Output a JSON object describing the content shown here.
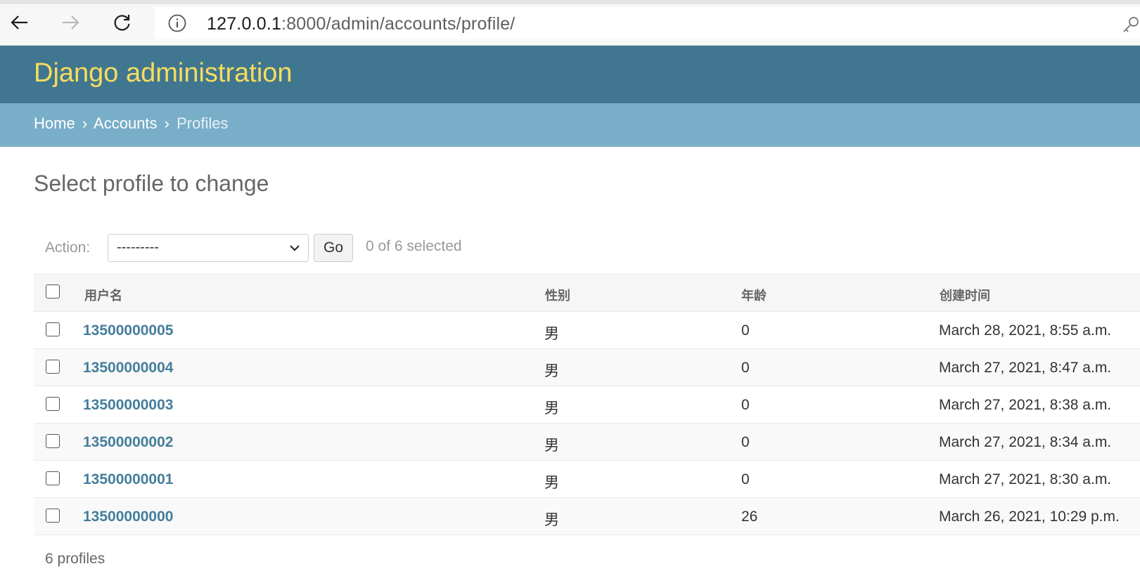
{
  "browser": {
    "url_host": "127.0.0.1",
    "url_rest": ":8000/admin/accounts/profile/"
  },
  "header": {
    "branding": "Django administration"
  },
  "breadcrumbs": {
    "home": "Home",
    "accounts": "Accounts",
    "current": "Profiles",
    "separator": "›"
  },
  "page": {
    "title": "Select profile to change"
  },
  "actions": {
    "label": "Action:",
    "selected_option": "---------",
    "go_label": "Go",
    "selection_status": "0 of 6 selected"
  },
  "table": {
    "columns": [
      "用户名",
      "性别",
      "年龄",
      "创建时间"
    ],
    "rows": [
      {
        "username": "13500000005",
        "gender": "男",
        "age": "0",
        "created": "March 28, 2021, 8:55 a.m."
      },
      {
        "username": "13500000004",
        "gender": "男",
        "age": "0",
        "created": "March 27, 2021, 8:47 a.m."
      },
      {
        "username": "13500000003",
        "gender": "男",
        "age": "0",
        "created": "March 27, 2021, 8:38 a.m."
      },
      {
        "username": "13500000002",
        "gender": "男",
        "age": "0",
        "created": "March 27, 2021, 8:34 a.m."
      },
      {
        "username": "13500000001",
        "gender": "男",
        "age": "0",
        "created": "March 27, 2021, 8:30 a.m."
      },
      {
        "username": "13500000000",
        "gender": "男",
        "age": "26",
        "created": "March 26, 2021, 10:29 p.m."
      }
    ]
  },
  "paginator": {
    "count_text": "6 profiles"
  },
  "colors": {
    "header_bg": "#417690",
    "branding": "#f5dd5d",
    "breadcrumbs_bg": "#79aec8",
    "link": "#447e9b"
  },
  "icons": [
    "back-arrow-icon",
    "forward-arrow-icon",
    "reload-icon",
    "site-info-icon",
    "key-icon",
    "chevron-down-icon"
  ]
}
